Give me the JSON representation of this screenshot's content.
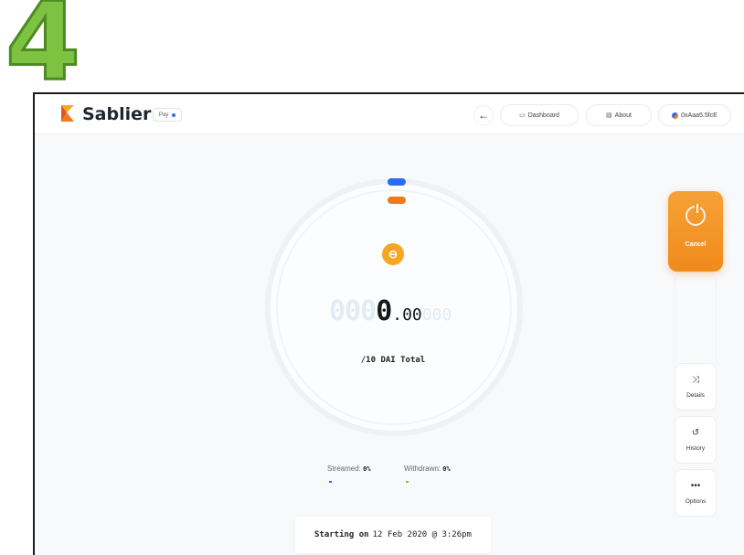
{
  "step_number": "4",
  "header": {
    "brand": "Sablier",
    "network_select": "Pay",
    "back_glyph": "←",
    "nav": {
      "dashboard": "Dashboard",
      "about": "About",
      "account": "0xAaa5.5fcE"
    }
  },
  "stream": {
    "amount_ghost_lead": "000",
    "amount_main": "0",
    "amount_decimals": ".00",
    "amount_ghost_trail": "000",
    "total_label": "/10 DAI Total",
    "streamed_label": "Streamed:",
    "streamed_value": "0%",
    "withdrawn_label": "Withdrawn:",
    "withdrawn_value": "0%",
    "streamed_progress": 0,
    "withdrawn_progress": 0,
    "start_prefix": "Starting on",
    "start_date": "12 Feb 2020 @ 3:26pm"
  },
  "actions": {
    "cancel": "Cancel",
    "details": "Details",
    "history": "History",
    "options": "Options"
  },
  "icons": {
    "token": "dai-token-icon",
    "cancel": "power-icon",
    "details": "details-icon",
    "history": "history-icon",
    "options": "more-icon"
  },
  "colors": {
    "accent_orange": "#f08a1c",
    "accent_blue": "#2a6df4",
    "step_green": "#7dc241",
    "token_yellow": "#f6a623"
  }
}
